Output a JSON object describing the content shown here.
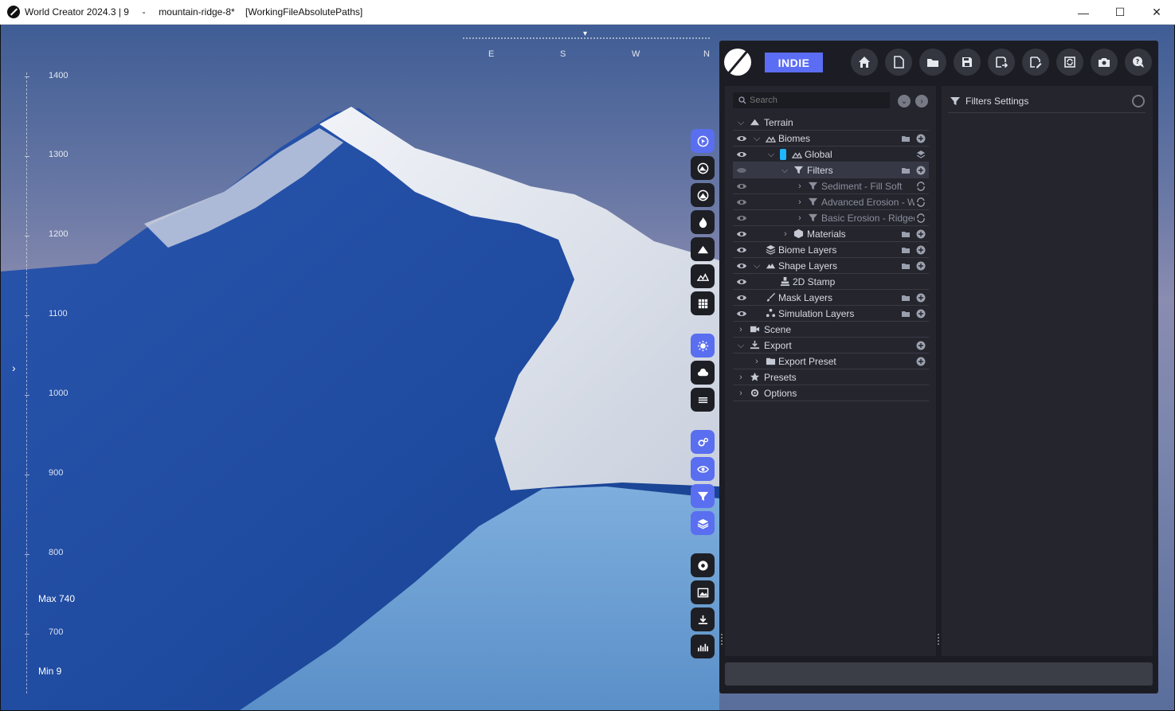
{
  "window": {
    "title": "World Creator 2024.3 | 9     -     mountain-ridge-8*    [WorkingFileAbsolutePaths]",
    "controls": {
      "minimize": "—",
      "maximize": "☐",
      "close": "✕"
    }
  },
  "viewport": {
    "ruler_ticks": [
      "1400",
      "1300",
      "1200",
      "1100",
      "1000",
      "900",
      "800",
      "700"
    ],
    "max_label": "Max 740",
    "min_label": "Min 9",
    "compass": [
      "E",
      "S",
      "W",
      "N"
    ],
    "colors": {
      "terrain_blue": "#1e4aa0",
      "snow": "#e8ecf2",
      "water": "#6d9fd1"
    }
  },
  "vertical_toolbar": [
    {
      "name": "sculpt",
      "icon": "globe-cursor-icon",
      "active": true
    },
    {
      "name": "terrain-view",
      "icon": "mountain-circle-icon",
      "active": false
    },
    {
      "name": "terrain-view-2",
      "icon": "mountain-circle-2-icon",
      "active": false
    },
    {
      "name": "fire",
      "icon": "flame-icon",
      "active": false
    },
    {
      "name": "mountain",
      "icon": "mountain-icon",
      "active": false
    },
    {
      "name": "biome",
      "icon": "biome-icon",
      "active": false
    },
    {
      "name": "grid",
      "icon": "grid-icon",
      "active": false
    },
    {
      "name": "sun",
      "icon": "sun-icon",
      "active": true
    },
    {
      "name": "clouds",
      "icon": "cloud-icon",
      "active": false
    },
    {
      "name": "water",
      "icon": "waves-icon",
      "active": false
    },
    {
      "name": "settings",
      "icon": "gears-icon",
      "active": true
    },
    {
      "name": "visibility",
      "icon": "eye-icon",
      "active": true
    },
    {
      "name": "filter",
      "icon": "filter-icon",
      "active": true
    },
    {
      "name": "layers",
      "icon": "layers-icon",
      "active": true
    },
    {
      "name": "record",
      "icon": "record-icon",
      "active": false
    },
    {
      "name": "image",
      "icon": "image-icon",
      "active": false
    },
    {
      "name": "download",
      "icon": "download-icon",
      "active": false
    },
    {
      "name": "stats",
      "icon": "chart-icon",
      "active": false
    }
  ],
  "header": {
    "badge": "INDIE",
    "buttons": [
      "home-icon",
      "new-file-icon",
      "open-folder-icon",
      "save-icon",
      "save-as-icon",
      "edit-file-icon",
      "sync-icon",
      "camera-icon",
      "help-chat-icon"
    ]
  },
  "search": {
    "placeholder": "Search"
  },
  "tree": [
    {
      "label": "Terrain"
    },
    {
      "label": "Biomes"
    },
    {
      "label": "Global"
    },
    {
      "label": "Filters"
    },
    {
      "label": "Sediment - Fill Soft"
    },
    {
      "label": "Advanced Erosion - Wa"
    },
    {
      "label": "Basic Erosion - Ridged"
    },
    {
      "label": "Materials"
    },
    {
      "label": "Biome Layers"
    },
    {
      "label": "Shape Layers"
    },
    {
      "label": "2D Stamp"
    },
    {
      "label": "Mask Layers"
    },
    {
      "label": "Simulation Layers"
    },
    {
      "label": "Scene"
    },
    {
      "label": "Export"
    },
    {
      "label": "Export Preset"
    },
    {
      "label": "Presets"
    },
    {
      "label": "Options"
    }
  ],
  "settings": {
    "title": "Filters Settings"
  },
  "accent": "#5b6df5"
}
